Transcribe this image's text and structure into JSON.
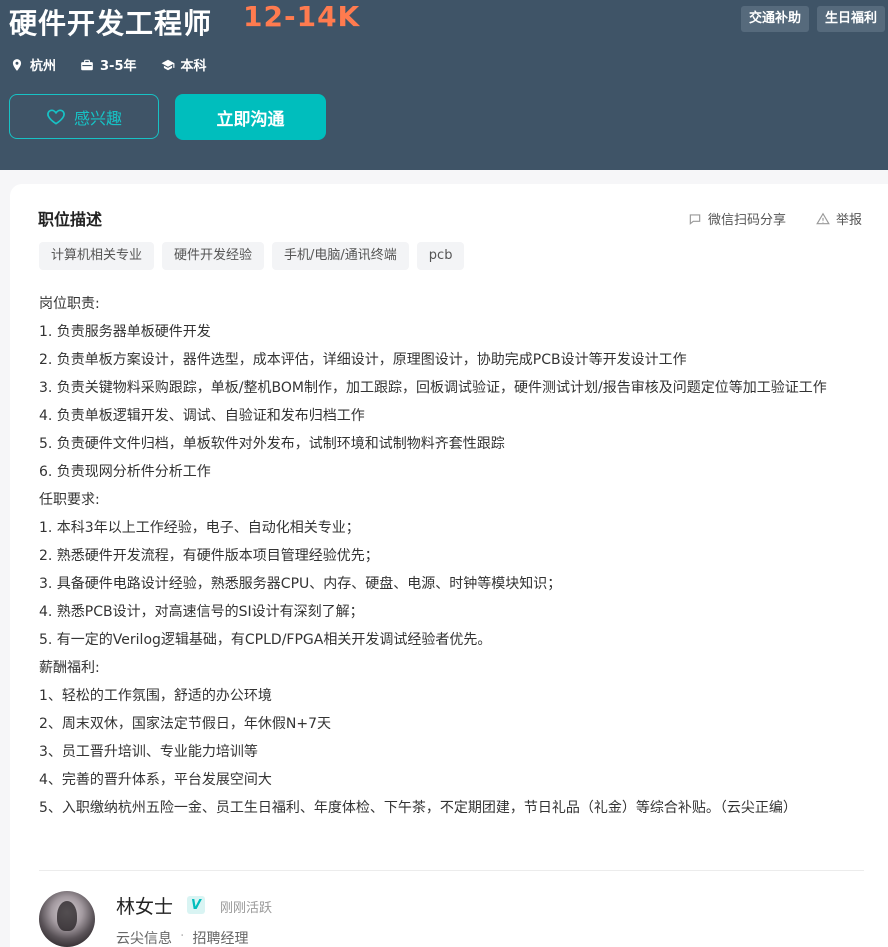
{
  "header": {
    "title": "硬件开发工程师",
    "salary": "12-14K",
    "benefits": [
      "交通补助",
      "生日福利"
    ],
    "meta": {
      "location": "杭州",
      "experience": "3-5年",
      "degree": "本科"
    },
    "interest_label": "感兴趣",
    "chat_label": "立即沟通"
  },
  "card": {
    "section_title": "职位描述",
    "share_label": "微信扫码分享",
    "report_label": "举报",
    "skills": [
      "计算机相关专业",
      "硬件开发经验",
      "手机/电脑/通讯终端",
      "pcb"
    ],
    "description": [
      "岗位职责:",
      "1. 负责服务器单板硬件开发",
      "2. 负责单板方案设计，器件选型，成本评估，详细设计，原理图设计，协助完成PCB设计等开发设计工作",
      "3. 负责关键物料采购跟踪，单板/整机BOM制作，加工跟踪，回板调试验证，硬件测试计划/报告审核及问题定位等加工验证工作",
      "4. 负责单板逻辑开发、调试、自验证和发布归档工作",
      "5. 负责硬件文件归档，单板软件对外发布，试制环境和试制物料齐套性跟踪",
      "6. 负责现网分析件分析工作",
      "任职要求:",
      "1. 本科3年以上工作经验，电子、自动化相关专业；",
      "2. 熟悉硬件开发流程，有硬件版本项目管理经验优先；",
      "3. 具备硬件电路设计经验，熟悉服务器CPU、内存、硬盘、电源、时钟等模块知识；",
      "4. 熟悉PCB设计，对高速信号的SI设计有深刻了解；",
      "5. 有一定的Verilog逻辑基础，有CPLD/FPGA相关开发调试经验者优先。",
      "薪酬福利:",
      "1、轻松的工作氛围，舒适的办公环境",
      "2、周末双休，国家法定节假日，年休假N+7天",
      "3、员工晋升培训、专业能力培训等",
      "4、完善的晋升体系，平台发展空间大",
      "5、入职缴纳杭州五险一金、员工生日福利、年度体检、下午茶，不定期团建，节日礼品（礼金）等综合补贴。（云尖正编）"
    ],
    "recruiter": {
      "name": "林女士",
      "verify_badge": "V",
      "status": "刚刚活跃",
      "company": "云尖信息",
      "separator": "·",
      "role": "招聘经理"
    }
  }
}
